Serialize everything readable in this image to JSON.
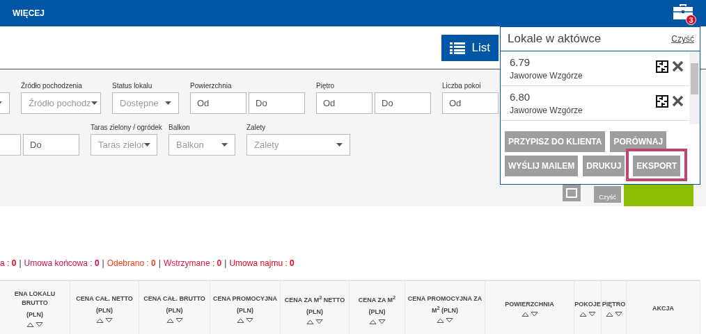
{
  "top_bar": {
    "menu_label": "WIĘCEJ",
    "briefcase_badge": "3"
  },
  "view_button": {
    "label": "List"
  },
  "filters": {
    "rows": [
      {
        "fields": [
          {
            "kind": "select"
          },
          {
            "kind": "select",
            "label": "Źródło pochodzenia",
            "placeholder": "Źródło pochodz"
          },
          {
            "kind": "select",
            "label": "Status lokalu",
            "value": "Dostępne"
          },
          {
            "kind": "range",
            "label": "Powierzchnia",
            "inputs": [
              {
                "placeholder": "Od"
              },
              {
                "placeholder": "Do"
              }
            ]
          },
          {
            "kind": "range",
            "label": "Piętro",
            "inputs": [
              {
                "placeholder": "Od"
              },
              {
                "placeholder": "Do"
              }
            ]
          },
          {
            "kind": "range",
            "label": "Liczba pokoi",
            "inputs": [
              {
                "placeholder": "Od"
              }
            ]
          }
        ]
      },
      {
        "fields": [
          {
            "kind": "range",
            "inputs": [
              {
                "placeholder": "Do"
              }
            ]
          },
          {
            "kind": "select",
            "label": "Taras zielony / ogródek",
            "placeholder": "Taras zielor"
          },
          {
            "kind": "select",
            "label": "Balkon",
            "placeholder": "Balkon"
          },
          {
            "kind": "select",
            "label": "Zalety",
            "placeholder": "Zalety"
          }
        ]
      }
    ],
    "clear_label": "Czyść"
  },
  "status_summary": [
    {
      "text": "a : **0**",
      "color": "#e8001c"
    },
    {
      "text": "Umowa końcowa : **0**",
      "color": "#c8104e"
    },
    {
      "text": "Odebrano : **0**",
      "color": "#f0401c"
    },
    {
      "text": "Wstrzymane : **0**",
      "color": "#e01838"
    },
    {
      "text": "Umowa najmu : **0**",
      "color": "#e8001c"
    }
  ],
  "status_separator": "|",
  "table": {
    "columns": [
      {
        "label": "ENA LOKALU BRUTTO",
        "unit": "(PLN)",
        "sortable": true
      },
      {
        "label": "CENA CAŁ. NETTO",
        "unit": "(PLN)",
        "sortable": true
      },
      {
        "label": "CENA CAŁ. BRUTTO",
        "unit": "(PLN)",
        "sortable": true
      },
      {
        "label": "CENA PROMOCYJNA",
        "unit": "(PLN)",
        "sortable": true
      },
      {
        "label": "CENA ZA M$^{2}$ NETTO",
        "unit": "(PLN)",
        "sortable": true
      },
      {
        "label": "CENA ZA M$^{2}$",
        "unit": "(PLN)",
        "sortable": true
      },
      {
        "label": "CENA PROMOCYJNA ZA M$^{2}$ (PLN)",
        "sortable": true
      },
      {
        "label": "POWIERZCHNIA",
        "sortable": true
      },
      {
        "label": "POKOJE",
        "sortable": true
      },
      {
        "label": "PIĘTRO",
        "sortable": true
      },
      {
        "label": "AKCJA",
        "sortable": false
      }
    ]
  },
  "briefcase_popup": {
    "title": "Lokale w aktówce",
    "clear_link": "Czyść",
    "items": [
      {
        "number": "6.79",
        "investment": "Jaworowe Wzgórze"
      },
      {
        "number": "6.80",
        "investment": "Jaworowe Wzgórze"
      }
    ],
    "buttons": [
      {
        "label": "PRZYPISZ DO KLIENTA",
        "highlighted": false
      },
      {
        "label": "PORÓWNAJ",
        "highlighted": false
      },
      {
        "label": "WYŚLIJ MAILEM",
        "highlighted": false
      },
      {
        "label": "DRUKUJ",
        "highlighted": false
      },
      {
        "label": "EKSPORT",
        "highlighted": true
      }
    ]
  }
}
